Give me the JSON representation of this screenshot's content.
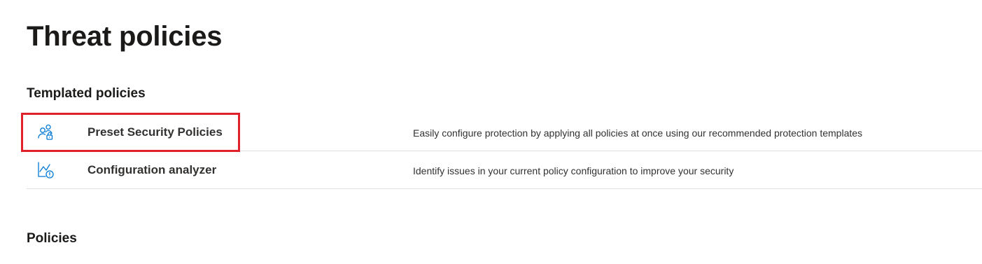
{
  "page": {
    "title": "Threat policies"
  },
  "sections": {
    "templated_heading": "Templated policies",
    "policies_heading": "Policies"
  },
  "templated_policies": [
    {
      "icon": "user-lock-icon",
      "name": "Preset Security Policies",
      "description": "Easily configure protection by applying all policies at once using our recommended protection templates",
      "highlighted": true
    },
    {
      "icon": "chart-alert-icon",
      "name": "Configuration analyzer",
      "description": "Identify issues in your current policy configuration to improve your security",
      "highlighted": false
    }
  ],
  "colors": {
    "icon_accent": "#0078d4",
    "highlight_border": "#e0202a",
    "divider": "#e1dfdd"
  }
}
